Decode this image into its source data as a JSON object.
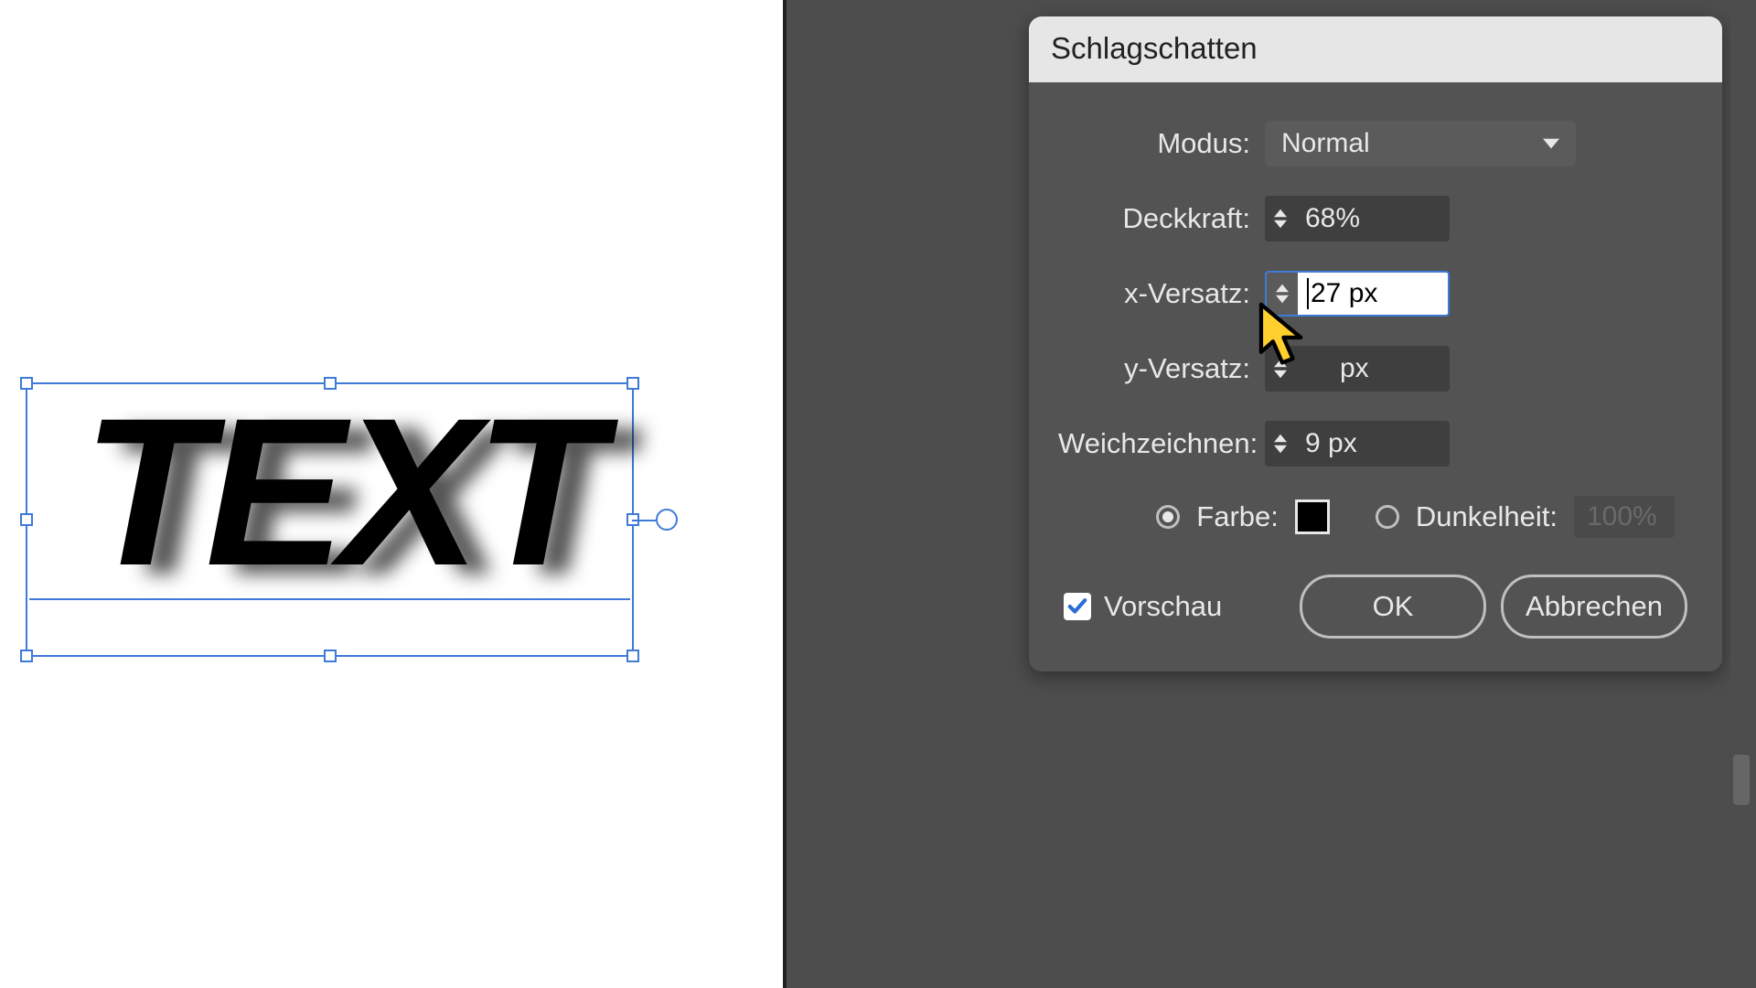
{
  "canvas": {
    "text": "TEXT"
  },
  "dialog": {
    "title": "Schlagschatten",
    "mode": {
      "label": "Modus:",
      "value": "Normal"
    },
    "opacity": {
      "label": "Deckkraft:",
      "value": "68%"
    },
    "x_offset": {
      "label": "x-Versatz:",
      "value": "27 px"
    },
    "y_offset": {
      "label": "y-Versatz:",
      "value_suffix": "px"
    },
    "blur": {
      "label": "Weichzeichnen:",
      "value": "9 px"
    },
    "color": {
      "label": "Farbe:",
      "swatch": "#000000"
    },
    "darkness": {
      "label": "Dunkelheit:",
      "value": "100%"
    },
    "preview_label": "Vorschau",
    "ok_label": "OK",
    "cancel_label": "Abbrechen"
  }
}
